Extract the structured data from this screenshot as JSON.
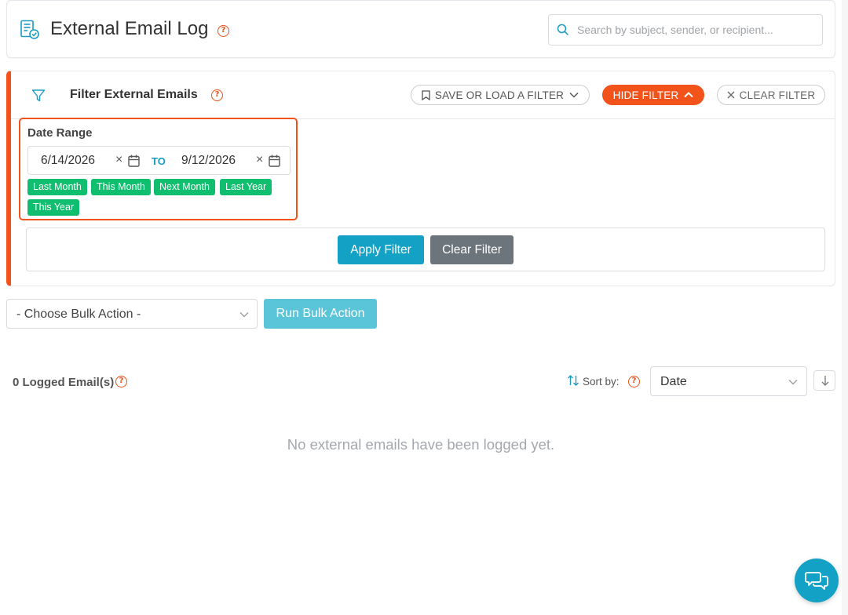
{
  "header": {
    "title": "External Email Log",
    "help_glyph": "?",
    "search_placeholder": "Search by subject, sender, or recipient..."
  },
  "filter": {
    "title": "Filter External Emails",
    "help_glyph": "?",
    "save_load_label": "SAVE OR LOAD A FILTER",
    "hide_label": "HIDE FILTER",
    "clear_label": "CLEAR FILTER",
    "date_range": {
      "label": "Date Range",
      "from": "6/14/2026",
      "to_label": "TO",
      "to": "9/12/2026",
      "clear_glyph": "×",
      "quick_ranges": [
        "Last Month",
        "This Month",
        "Next Month",
        "Last Year",
        "This Year"
      ]
    },
    "apply_label": "Apply Filter",
    "clear_button_label": "Clear Filter"
  },
  "bulk": {
    "select_value": "- Choose Bulk Action -",
    "run_label": "Run Bulk Action"
  },
  "results": {
    "count_label": "0 Logged Email(s)",
    "help_glyph": "?",
    "sort_label": "Sort by:",
    "sort_value": "Date",
    "empty_message": "No external emails have been logged yet."
  },
  "colors": {
    "accent_orange": "#f2531b",
    "primary_blue": "#13a2c5",
    "chip_green": "#0fbe6e",
    "secondary_gray": "#6c757c"
  }
}
